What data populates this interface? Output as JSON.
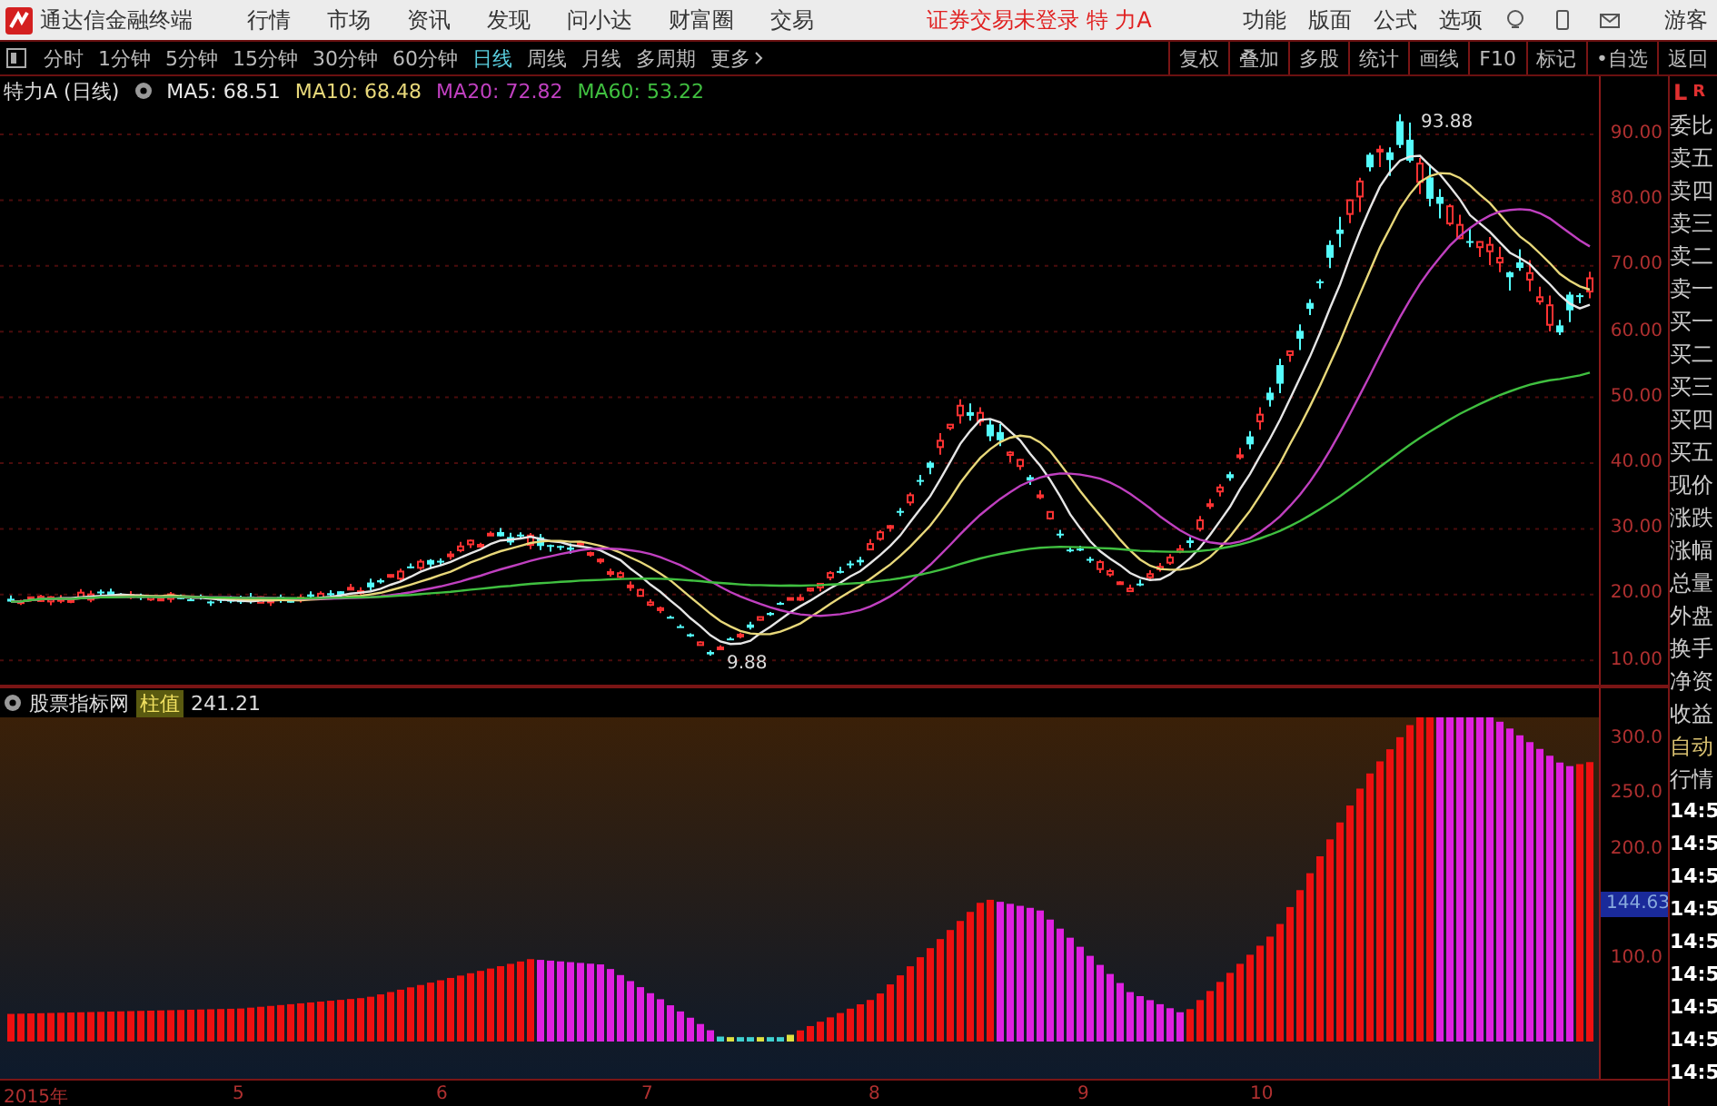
{
  "app": {
    "title": "通达信金融终端",
    "menu": [
      "行情",
      "市场",
      "资讯",
      "发现",
      "问小达",
      "财富圈",
      "交易"
    ],
    "login_status": "证券交易未登录  特 力A",
    "tools": [
      "功能",
      "版面",
      "公式",
      "选项"
    ],
    "user": "游客"
  },
  "toolbar": {
    "periods": [
      {
        "label": "分时",
        "selected": false
      },
      {
        "label": "1分钟",
        "selected": false
      },
      {
        "label": "5分钟",
        "selected": false
      },
      {
        "label": "15分钟",
        "selected": false
      },
      {
        "label": "30分钟",
        "selected": false
      },
      {
        "label": "60分钟",
        "selected": false
      },
      {
        "label": "日线",
        "selected": true
      },
      {
        "label": "周线",
        "selected": false
      },
      {
        "label": "月线",
        "selected": false
      },
      {
        "label": "多周期",
        "selected": false
      }
    ],
    "more": "更多",
    "actions": [
      "复权",
      "叠加",
      "多股",
      "统计",
      "画线",
      "F10",
      "标记",
      "•自选",
      "返回"
    ]
  },
  "price_chart": {
    "title": "特力A (日线)",
    "indicators": [
      {
        "label": "MA5: 68.51",
        "color": "#e6e6e6"
      },
      {
        "label": "MA10: 68.48",
        "color": "#e8d87a"
      },
      {
        "label": "MA20: 72.82",
        "color": "#c040c0"
      },
      {
        "label": "MA60: 53.22",
        "color": "#40c040"
      }
    ],
    "axis_labels": [
      "90.00",
      "80.00",
      "70.00",
      "60.00",
      "50.00",
      "40.00",
      "30.00",
      "20.00",
      "10.00"
    ],
    "high_label": "93.88",
    "low_label": "9.88"
  },
  "indicator_chart": {
    "title": "股票指标网",
    "value_label": "柱值",
    "value": "241.21",
    "axis_labels": [
      "300.0",
      "250.0",
      "200.0"
    ],
    "current_value": "144.63",
    "axis_labels_below": [
      "100.0"
    ]
  },
  "time_axis": [
    "2015年",
    "5",
    "6",
    "7",
    "8",
    "9",
    "10"
  ],
  "sidebar": {
    "header": [
      "L",
      "R"
    ],
    "items": [
      {
        "label": "委比",
        "kind": "field"
      },
      {
        "label": "卖五",
        "kind": "field"
      },
      {
        "label": "卖四",
        "kind": "field"
      },
      {
        "label": "卖三",
        "kind": "field"
      },
      {
        "label": "卖二",
        "kind": "field"
      },
      {
        "label": "卖一",
        "kind": "field"
      },
      {
        "label": "买一",
        "kind": "field"
      },
      {
        "label": "买二",
        "kind": "field"
      },
      {
        "label": "买三",
        "kind": "field"
      },
      {
        "label": "买四",
        "kind": "field"
      },
      {
        "label": "买五",
        "kind": "field"
      },
      {
        "label": "现价",
        "kind": "field"
      },
      {
        "label": "涨跌",
        "kind": "field"
      },
      {
        "label": "涨幅",
        "kind": "field"
      },
      {
        "label": "总量",
        "kind": "field"
      },
      {
        "label": "外盘",
        "kind": "field"
      },
      {
        "label": "换手",
        "kind": "field"
      },
      {
        "label": "净资",
        "kind": "field"
      },
      {
        "label": "收益",
        "kind": "field"
      },
      {
        "label": "自动",
        "kind": "toggle"
      },
      {
        "label": "行情",
        "kind": "field"
      },
      {
        "label": "14:5",
        "kind": "time"
      },
      {
        "label": "14:5",
        "kind": "time"
      },
      {
        "label": "14:5",
        "kind": "time"
      },
      {
        "label": "14:5",
        "kind": "time"
      },
      {
        "label": "14:5",
        "kind": "time"
      },
      {
        "label": "14:5",
        "kind": "time"
      },
      {
        "label": "14:5",
        "kind": "time"
      },
      {
        "label": "14:5",
        "kind": "time"
      },
      {
        "label": "14:5",
        "kind": "time"
      }
    ]
  }
}
